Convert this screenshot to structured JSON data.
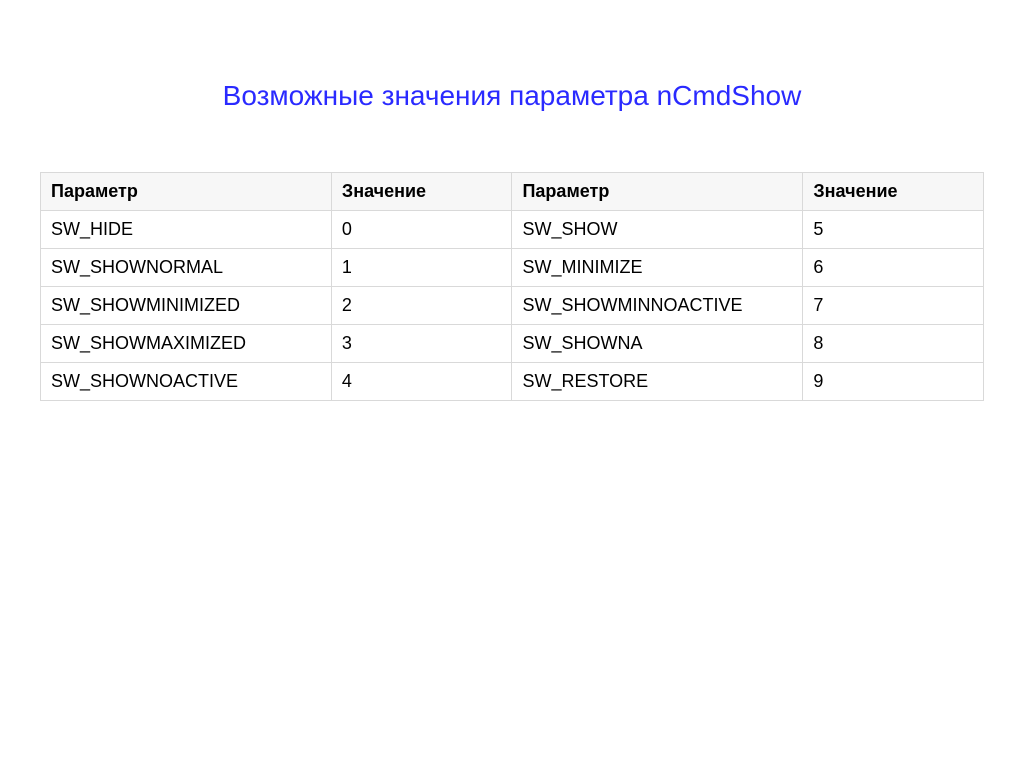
{
  "title": "Возможные значения параметра nCmdShow",
  "headers": {
    "param": "Параметр",
    "value": "Значение"
  },
  "rows": [
    {
      "p1": "SW_HIDE",
      "v1": "0",
      "p2": "SW_SHOW",
      "v2": "5"
    },
    {
      "p1": "SW_SHOWNORMAL",
      "v1": "1",
      "p2": "SW_MINIMIZE",
      "v2": "6"
    },
    {
      "p1": "SW_SHOWMINIMIZED",
      "v1": "2",
      "p2": "SW_SHOWMINNOACTIVE",
      "v2": "7"
    },
    {
      "p1": "SW_SHOWMAXIMIZED",
      "v1": "3",
      "p2": "SW_SHOWNA",
      "v2": "8"
    },
    {
      "p1": "SW_SHOWNOACTIVE",
      "v1": "4",
      "p2": "SW_RESTORE",
      "v2": "9"
    }
  ]
}
